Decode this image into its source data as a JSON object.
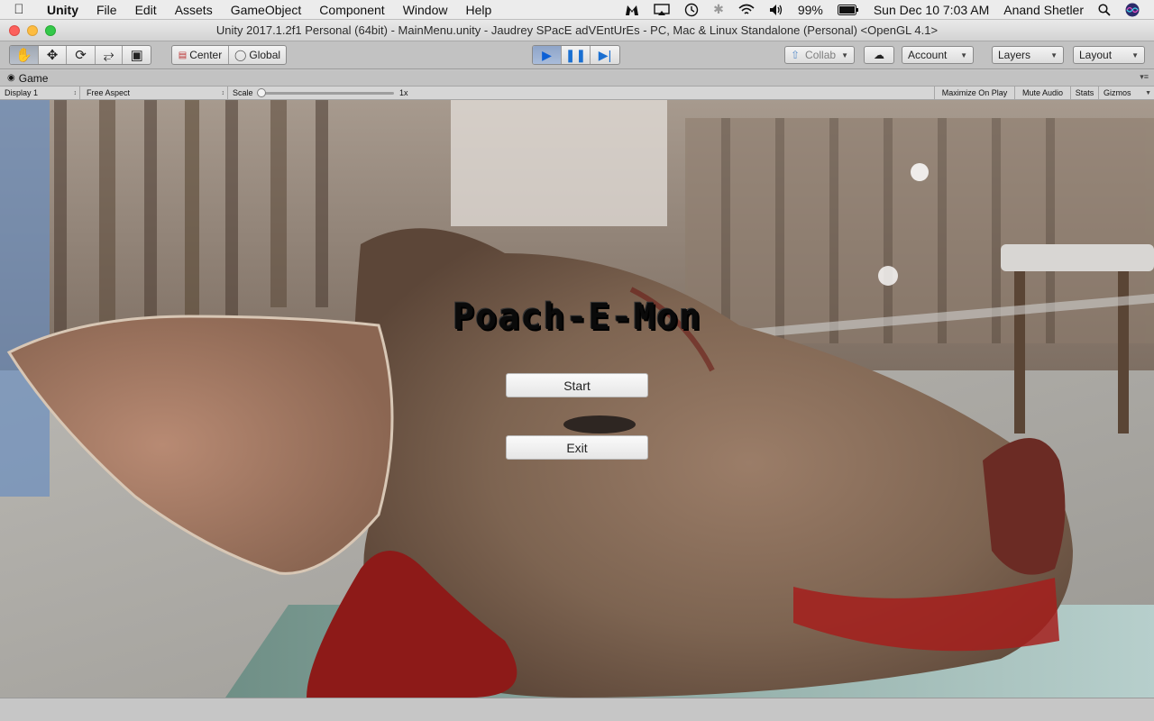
{
  "menubar": {
    "app": "Unity",
    "items": [
      "File",
      "Edit",
      "Assets",
      "GameObject",
      "Component",
      "Window",
      "Help"
    ],
    "battery": "99%",
    "clock": "Sun Dec 10  7:03 AM",
    "user": "Anand Shetler"
  },
  "window": {
    "title": "Unity 2017.1.2f1 Personal (64bit) - MainMenu.unity - Jaudrey SPacE adVEntUrEs - PC, Mac & Linux Standalone (Personal) <OpenGL 4.1>"
  },
  "toolbar": {
    "pivot_center": "Center",
    "pivot_global": "Global",
    "collab": "Collab",
    "account": "Account",
    "layers": "Layers",
    "layout": "Layout"
  },
  "game_tab": {
    "label": "Game",
    "display": "Display 1",
    "aspect": "Free Aspect",
    "scale_label": "Scale",
    "scale_value": "1x",
    "scale_level": 0.0,
    "maximize": "Maximize On Play",
    "mute": "Mute Audio",
    "stats": "Stats",
    "gizmos": "Gizmos"
  },
  "game_view": {
    "title": "Poach-E-Mon",
    "start_label": "Start",
    "exit_label": "Exit"
  },
  "colors": {
    "play_active": "#1a6fd1",
    "close": "#fc605c",
    "minimize": "#fdbc40",
    "maximize": "#34c84a"
  }
}
